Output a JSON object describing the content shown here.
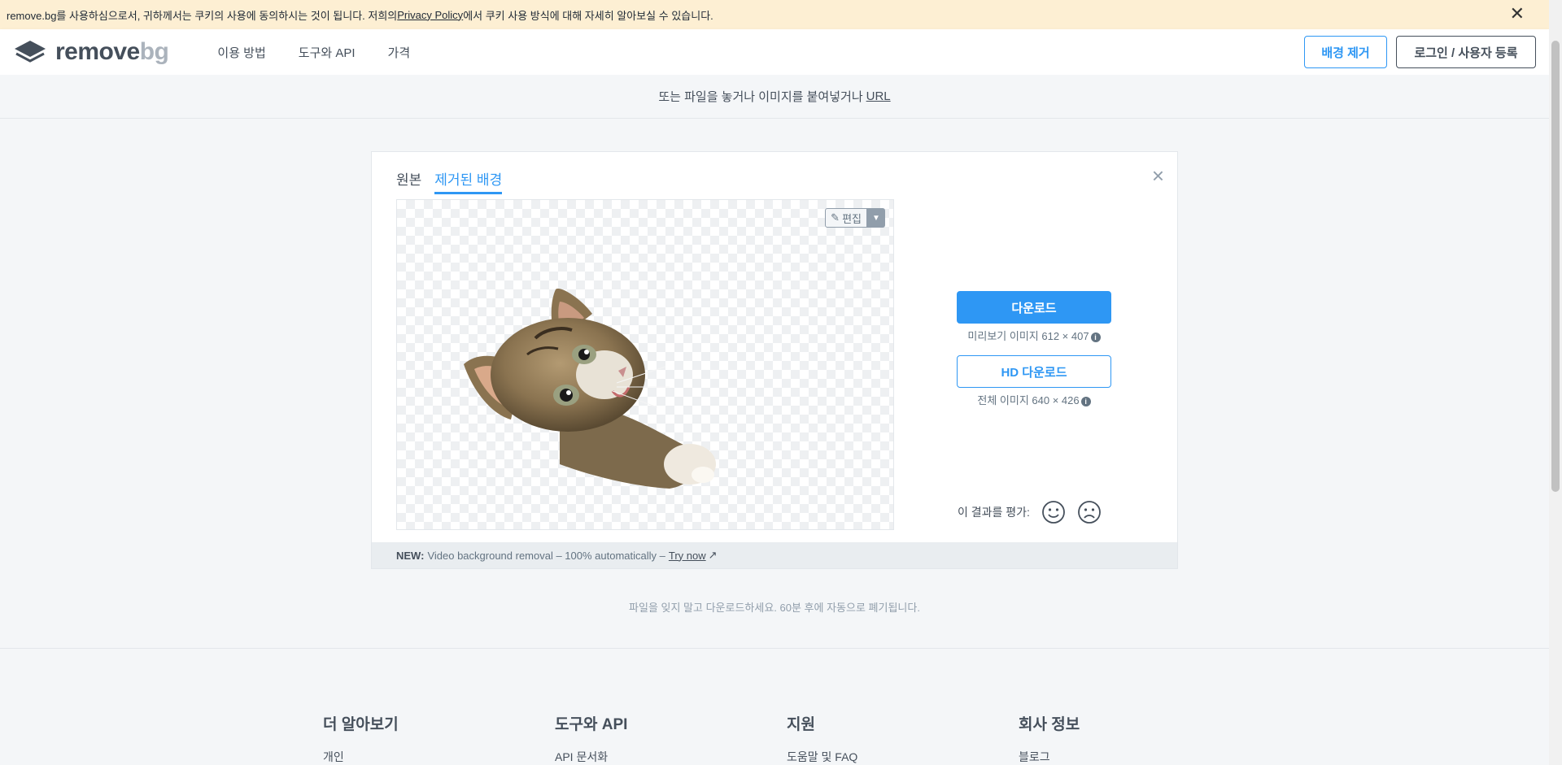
{
  "cookie_banner": {
    "text_before": "remove.bg를 사용하심으로서, 귀하께서는 쿠키의 사용에 동의하시는 것이 됩니다. 저희의 ",
    "link": "Privacy Policy",
    "text_after": "에서 쿠키 사용 방식에 대해 자세히 알아보실 수 있습니다.",
    "close": "✕"
  },
  "header": {
    "logo_a": "remove",
    "logo_b": "bg",
    "nav": [
      "이용 방법",
      "도구와 API",
      "가격"
    ],
    "remove_bg_button": "배경 제거",
    "login_button": "로그인 / 사용자 등록"
  },
  "upload": {
    "text": "또는 파일을 놓거나 이미지를 붙여넣거나",
    "url_link": "URL"
  },
  "result": {
    "tabs": [
      "원본",
      "제거된 배경"
    ],
    "active_tab": 1,
    "edit_label": "편집",
    "download_label": "다운로드",
    "preview_note": "미리보기 이미지 612 × 407",
    "hd_download_label": "HD 다운로드",
    "full_note": "전체 이미지 640 × 426",
    "rate_label": "이 결과를 평가:",
    "footer_new": "NEW:",
    "footer_text": "Video background removal – 100% automatically –",
    "footer_link": "Try now"
  },
  "retention_note": "파일을 잊지 말고 다운로드하세요. 60분 후에 자동으로 폐기됩니다.",
  "footer": {
    "columns": [
      {
        "title": "더 알아보기",
        "first_item": "개인"
      },
      {
        "title": "도구와 API",
        "first_item": "API 문서화"
      },
      {
        "title": "지원",
        "first_item": "도움말 및 FAQ"
      },
      {
        "title": "회사 정보",
        "first_item": "블로그"
      }
    ]
  },
  "colors": {
    "accent": "#2e97f4",
    "cookie_bg": "#fdefd3",
    "text": "#454f5b"
  }
}
